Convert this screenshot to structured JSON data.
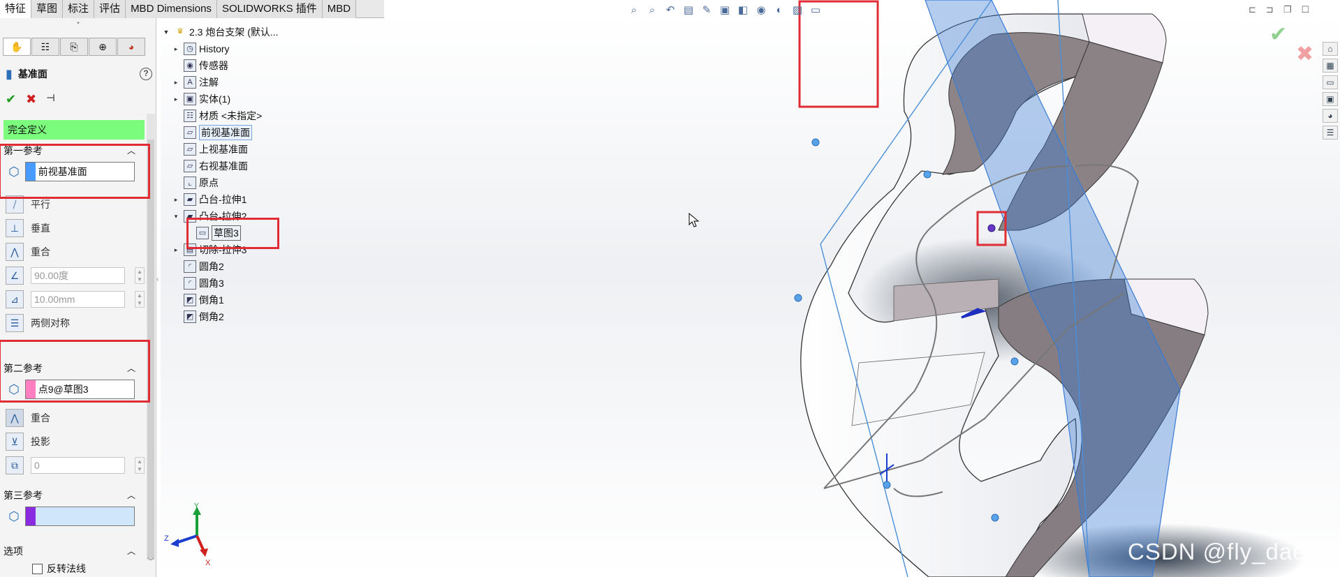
{
  "top_tabs": [
    "特征",
    "草图",
    "标注",
    "评估",
    "MBD Dimensions",
    "SOLIDWORKS 插件",
    "MBD"
  ],
  "property_manager": {
    "title": "基准面",
    "status": "完全定义",
    "first_ref": {
      "heading": "第一参考",
      "value": "前视基准面",
      "swatch_color": "#4a9bff",
      "options": [
        "平行",
        "垂直",
        "重合"
      ],
      "angle": "90.00度",
      "distance": "10.00mm",
      "symmetric": "两侧对称"
    },
    "second_ref": {
      "heading": "第二参考",
      "value": "点9@草图3",
      "swatch_color": "#ff7fc0",
      "options": [
        "重合",
        "投影"
      ],
      "count": "0"
    },
    "third_ref": {
      "heading": "第三参考",
      "value": "",
      "swatch_color": "#8a2be2"
    },
    "options_section": {
      "heading": "选项",
      "flip_normal": "反转法线"
    }
  },
  "feature_tree": {
    "root": "2.3 炮台支架  (默认...",
    "items": [
      {
        "label": "History",
        "expand": "collapsed",
        "icon": "history-icon"
      },
      {
        "label": "传感器",
        "expand": "none",
        "icon": "sensor-icon"
      },
      {
        "label": "注解",
        "expand": "collapsed",
        "icon": "annotation-icon"
      },
      {
        "label": "实体(1)",
        "expand": "collapsed",
        "icon": "solid-body-icon"
      },
      {
        "label": "材质 <未指定>",
        "expand": "none",
        "icon": "material-icon"
      },
      {
        "label": "前视基准面",
        "expand": "none",
        "icon": "plane-icon",
        "selected": true
      },
      {
        "label": "上视基准面",
        "expand": "none",
        "icon": "plane-icon"
      },
      {
        "label": "右视基准面",
        "expand": "none",
        "icon": "plane-icon"
      },
      {
        "label": "原点",
        "expand": "none",
        "icon": "origin-icon"
      },
      {
        "label": "凸台-拉伸1",
        "expand": "collapsed",
        "icon": "extrude-icon"
      },
      {
        "label": "凸台-拉伸2",
        "expand": "expanded",
        "icon": "extrude-icon"
      },
      {
        "label": "草图3",
        "expand": "none",
        "icon": "sketch-icon",
        "child": true
      },
      {
        "label": "切除-拉伸3",
        "expand": "collapsed",
        "icon": "cut-extrude-icon"
      },
      {
        "label": "圆角2",
        "expand": "none",
        "icon": "fillet-icon"
      },
      {
        "label": "圆角3",
        "expand": "none",
        "icon": "fillet-icon"
      },
      {
        "label": "倒角1",
        "expand": "none",
        "icon": "chamfer-icon"
      },
      {
        "label": "倒角2",
        "expand": "none",
        "icon": "chamfer-icon"
      }
    ]
  },
  "triad": {
    "y": "Y",
    "z": "Z",
    "x": "X"
  },
  "watermark": "CSDN @fly_daerm",
  "colors": {
    "highlight_red": "#e02c34",
    "status_green": "#7cfc7c",
    "plane_blue": "#4a8fd8"
  }
}
